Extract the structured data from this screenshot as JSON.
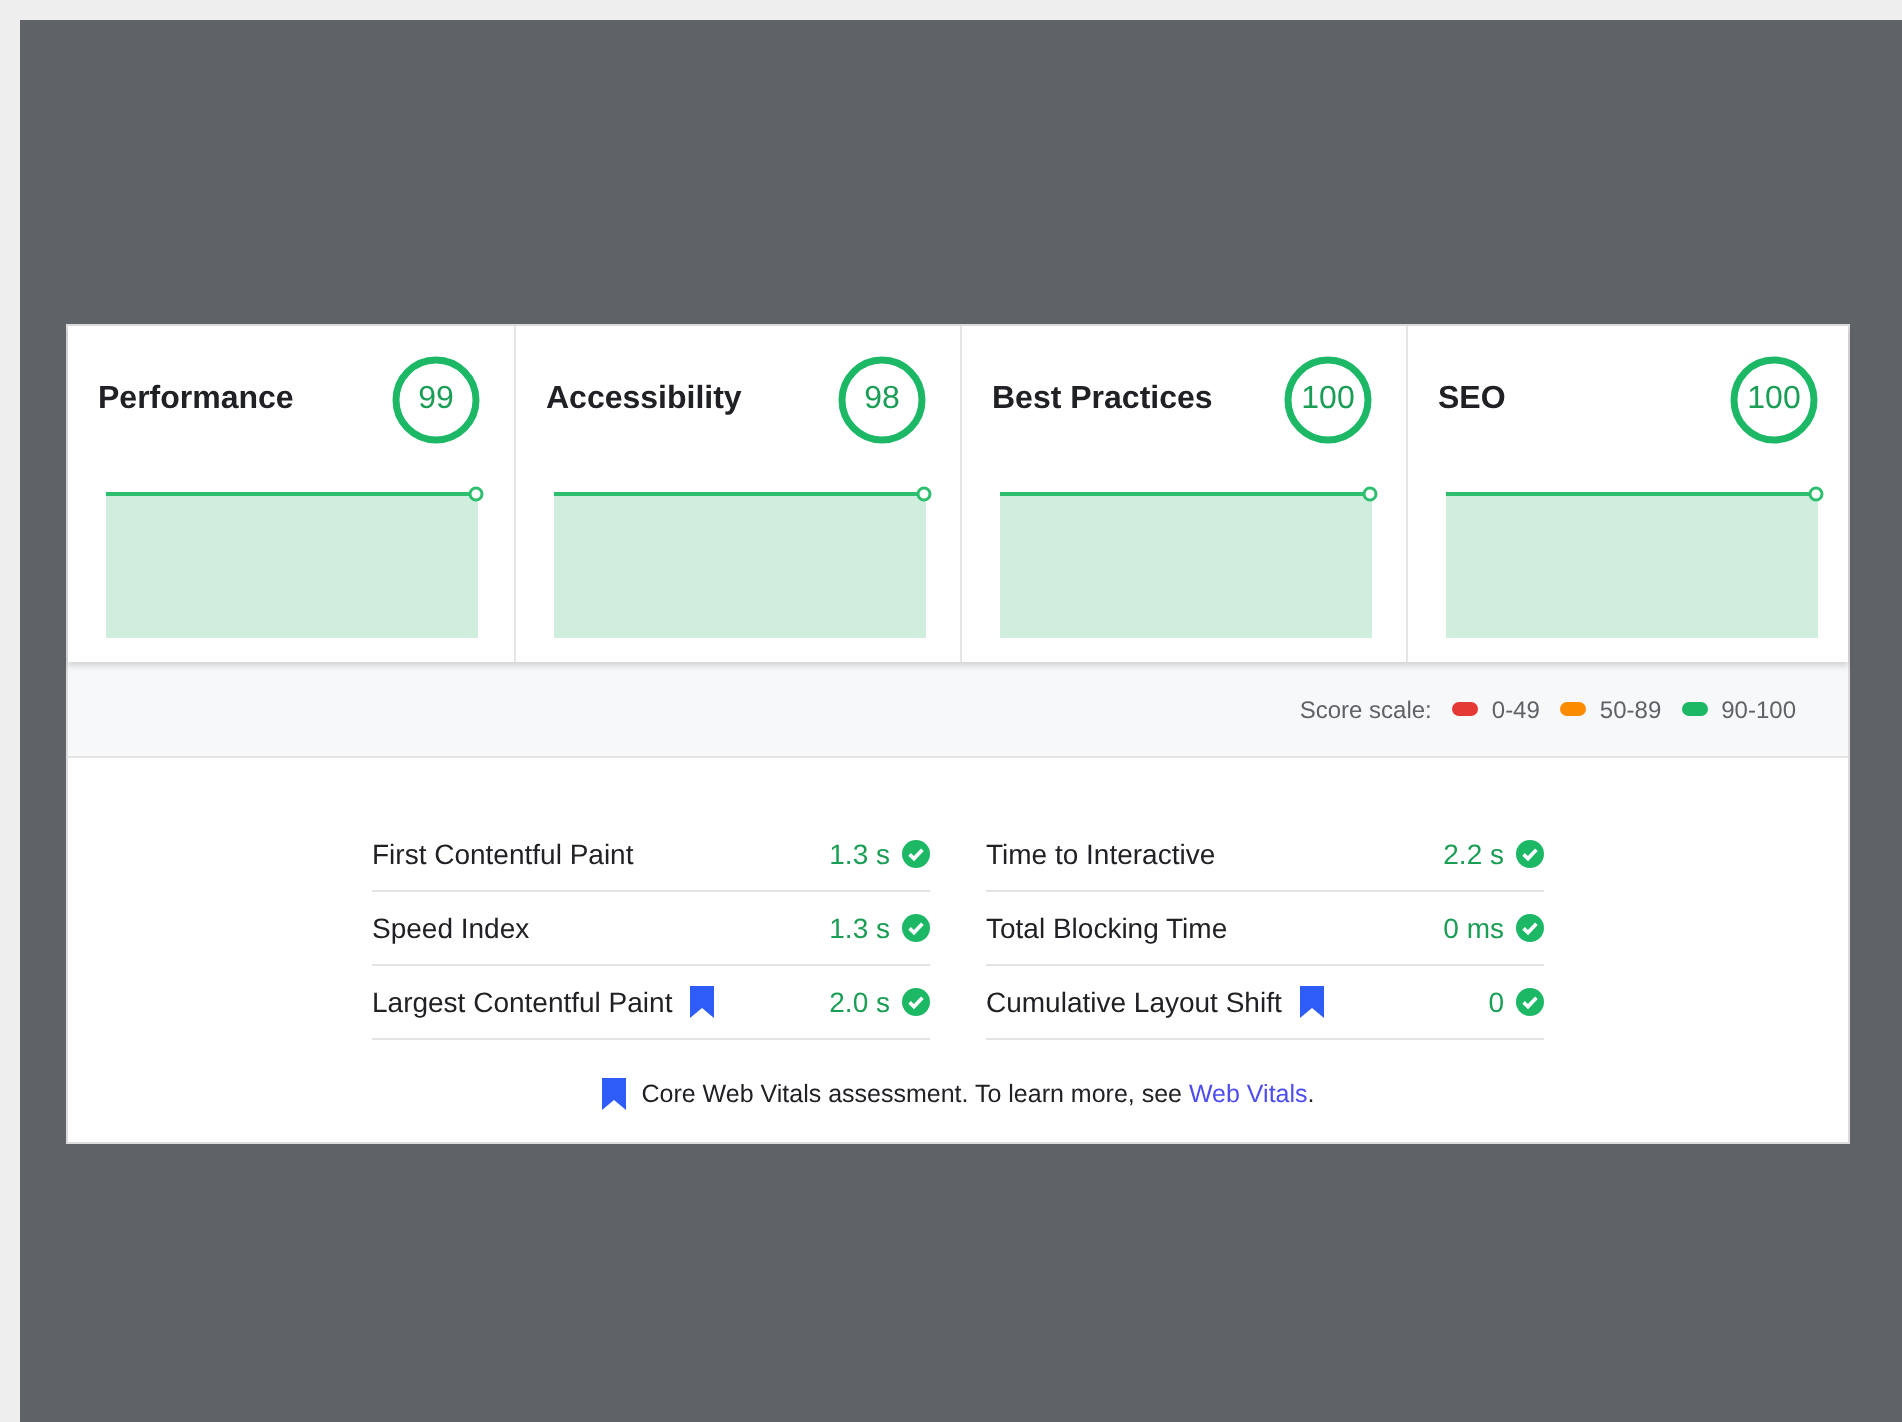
{
  "categories": [
    {
      "title": "Performance",
      "score": "99"
    },
    {
      "title": "Accessibility",
      "score": "98"
    },
    {
      "title": "Best Practices",
      "score": "100"
    },
    {
      "title": "SEO",
      "score": "100"
    }
  ],
  "score_scale": {
    "label": "Score scale:",
    "ranges": [
      {
        "label": "0-49",
        "color": "#e53935"
      },
      {
        "label": "50-89",
        "color": "#fb8c00"
      },
      {
        "label": "90-100",
        "color": "#1db866"
      }
    ]
  },
  "metrics": [
    {
      "name": "First Contentful Paint",
      "value": "1.3 s",
      "core_vital": false
    },
    {
      "name": "Time to Interactive",
      "value": "2.2 s",
      "core_vital": false
    },
    {
      "name": "Speed Index",
      "value": "1.3 s",
      "core_vital": false
    },
    {
      "name": "Total Blocking Time",
      "value": "0 ms",
      "core_vital": false
    },
    {
      "name": "Largest Contentful Paint",
      "value": "2.0 s",
      "core_vital": true
    },
    {
      "name": "Cumulative Layout Shift",
      "value": "0",
      "core_vital": true
    }
  ],
  "footnote": {
    "text": "Core Web Vitals assessment. To learn more, see",
    "link": "Web Vitals",
    "end": "."
  }
}
